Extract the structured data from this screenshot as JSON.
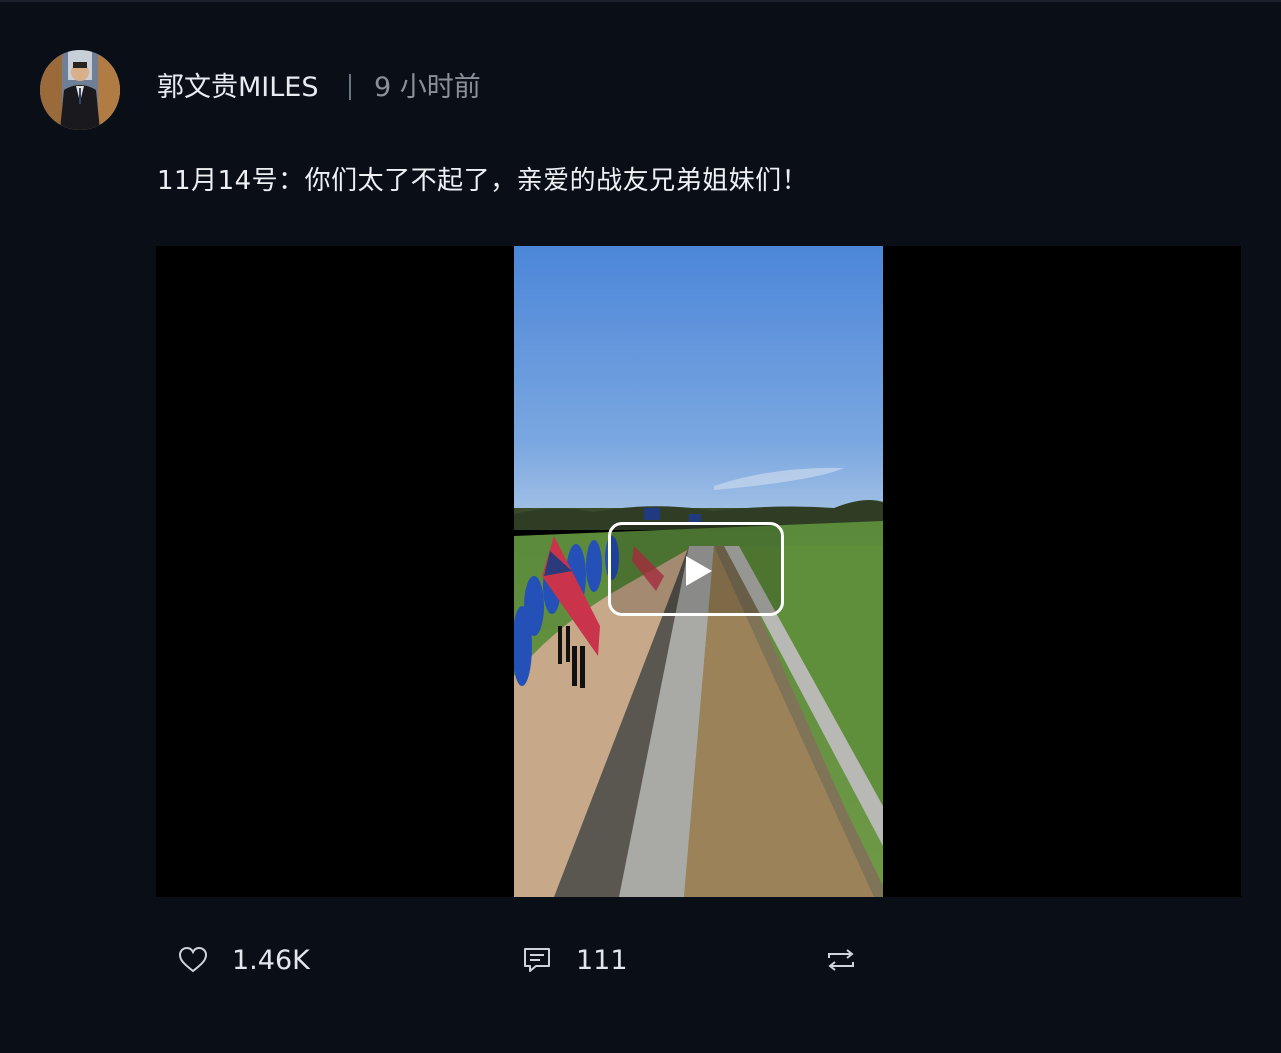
{
  "author": {
    "name": "郭文贵MILES",
    "time": "9 小时前"
  },
  "post": {
    "text": "11月14号：你们太了不起了，亲爱的战友兄弟姐妹们！"
  },
  "video": {
    "play_icon": "play-icon"
  },
  "actions": {
    "likes": "1.46K",
    "comments": "111",
    "like_icon": "heart-icon",
    "comment_icon": "comment-icon",
    "repost_icon": "repost-icon"
  }
}
